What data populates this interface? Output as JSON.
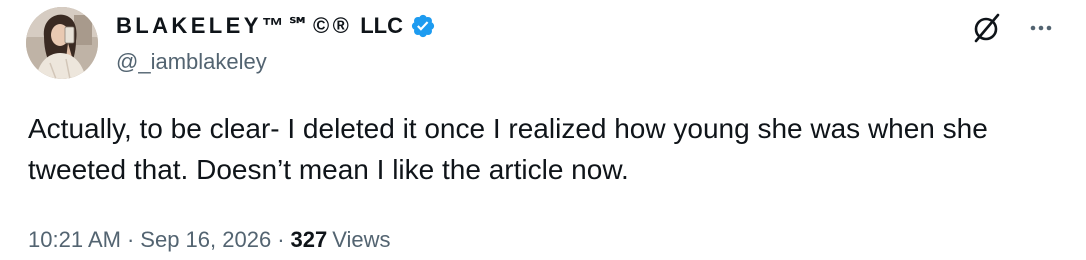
{
  "author": {
    "display_name": "BLAKELEY™℠©®",
    "display_name_suffix": "LLC",
    "handle": "@_iamblakeley",
    "verified": true,
    "verified_color": "#1d9bf0",
    "avatar_icon": "profile-photo"
  },
  "header_actions": {
    "grok_icon": "grok-icon",
    "more_icon": "more-options-icon"
  },
  "tweet": {
    "text": "Actually, to be clear- I deleted it once I realized how young she was when she tweeted that. Doesn’t mean I like the article now."
  },
  "meta": {
    "time": "10:21 AM",
    "separator_1": "·",
    "date": "Sep 16, 2026",
    "separator_2": "·",
    "views_count": "327",
    "views_label": "Views"
  },
  "colors": {
    "text_primary": "#0f1419",
    "text_secondary": "#536471",
    "accent": "#1d9bf0"
  }
}
